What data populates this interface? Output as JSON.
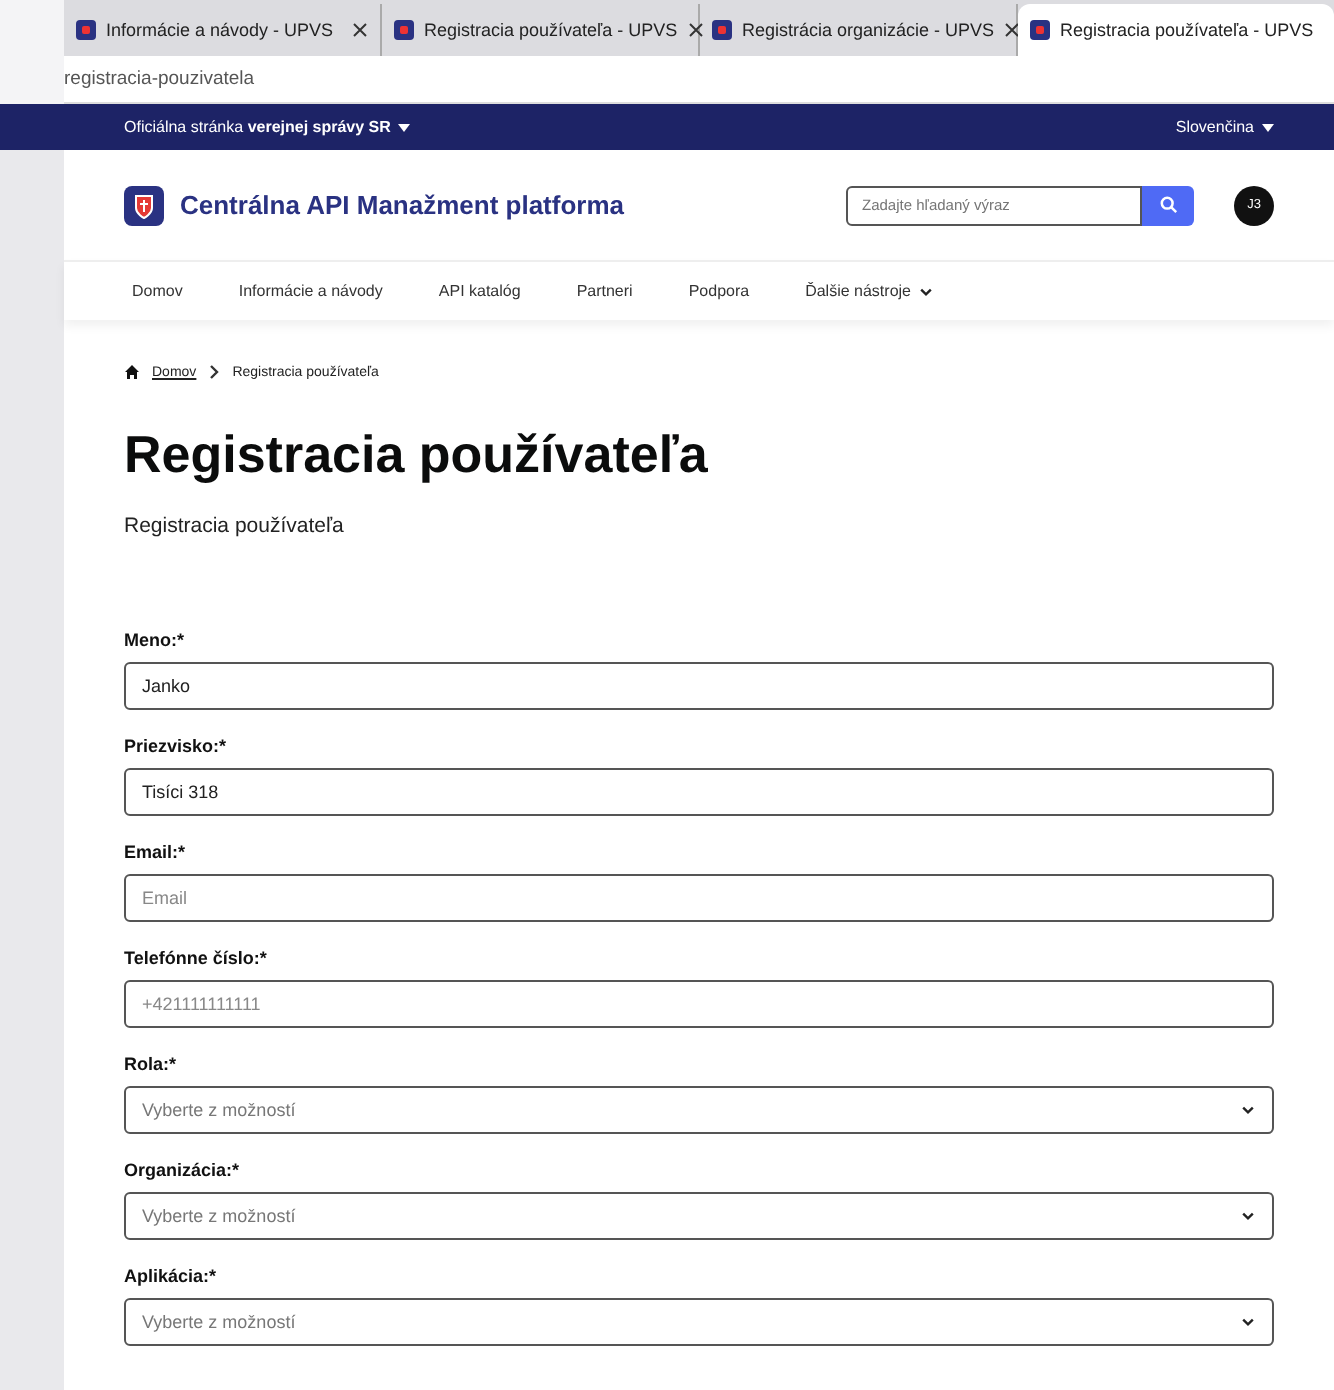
{
  "browser": {
    "tabs": [
      {
        "title": "Informácie a návody - UPVS",
        "selected": false
      },
      {
        "title": "Registracia používateľa - UPVS",
        "selected": false
      },
      {
        "title": "Registrácia organizácie - UPVS",
        "selected": false
      },
      {
        "title": "Registracia používateľa - UPVS",
        "selected": true
      }
    ],
    "address": "registracia-pouzivatela"
  },
  "top_bar": {
    "official": "Oficiálna stránka **verejnej správy SR**",
    "language": "Slovenčina"
  },
  "header": {
    "title": "Centrálna API Manažment platforma",
    "search_placeholder": "Zadajte hľadaný výraz",
    "avatar": "J3"
  },
  "nav": [
    {
      "label": "Domov",
      "has_menu": false
    },
    {
      "label": "Informácie a návody",
      "has_menu": false
    },
    {
      "label": "API katalóg",
      "has_menu": false
    },
    {
      "label": "Partneri",
      "has_menu": false
    },
    {
      "label": "Podpora",
      "has_menu": false
    },
    {
      "label": "Ďalšie nástroje",
      "has_menu": true
    }
  ],
  "breadcrumb": [
    {
      "label": "Domov",
      "link": true
    },
    {
      "label": "Registracia používateľa",
      "link": false
    }
  ],
  "page": {
    "title": "Registracia používateľa",
    "subtitle": "Registracia používateľa"
  },
  "form": [
    {
      "label": "Meno:*",
      "kind": "text",
      "value": "Janko"
    },
    {
      "label": "Priezvisko:*",
      "kind": "text",
      "value": "Tisíci 318"
    },
    {
      "label": "Email:*",
      "kind": "text",
      "placeholder": "Email"
    },
    {
      "label": "Telefónne číslo:*",
      "kind": "text",
      "placeholder": "+421111111111"
    },
    {
      "label": "Rola:*",
      "kind": "select",
      "placeholder": "Vyberte z možností"
    },
    {
      "label": "Organizácia:*",
      "kind": "select",
      "placeholder": "Vyberte z možností"
    },
    {
      "label": "Aplikácia:*",
      "kind": "select",
      "placeholder": "Vyberte z možností"
    }
  ]
}
